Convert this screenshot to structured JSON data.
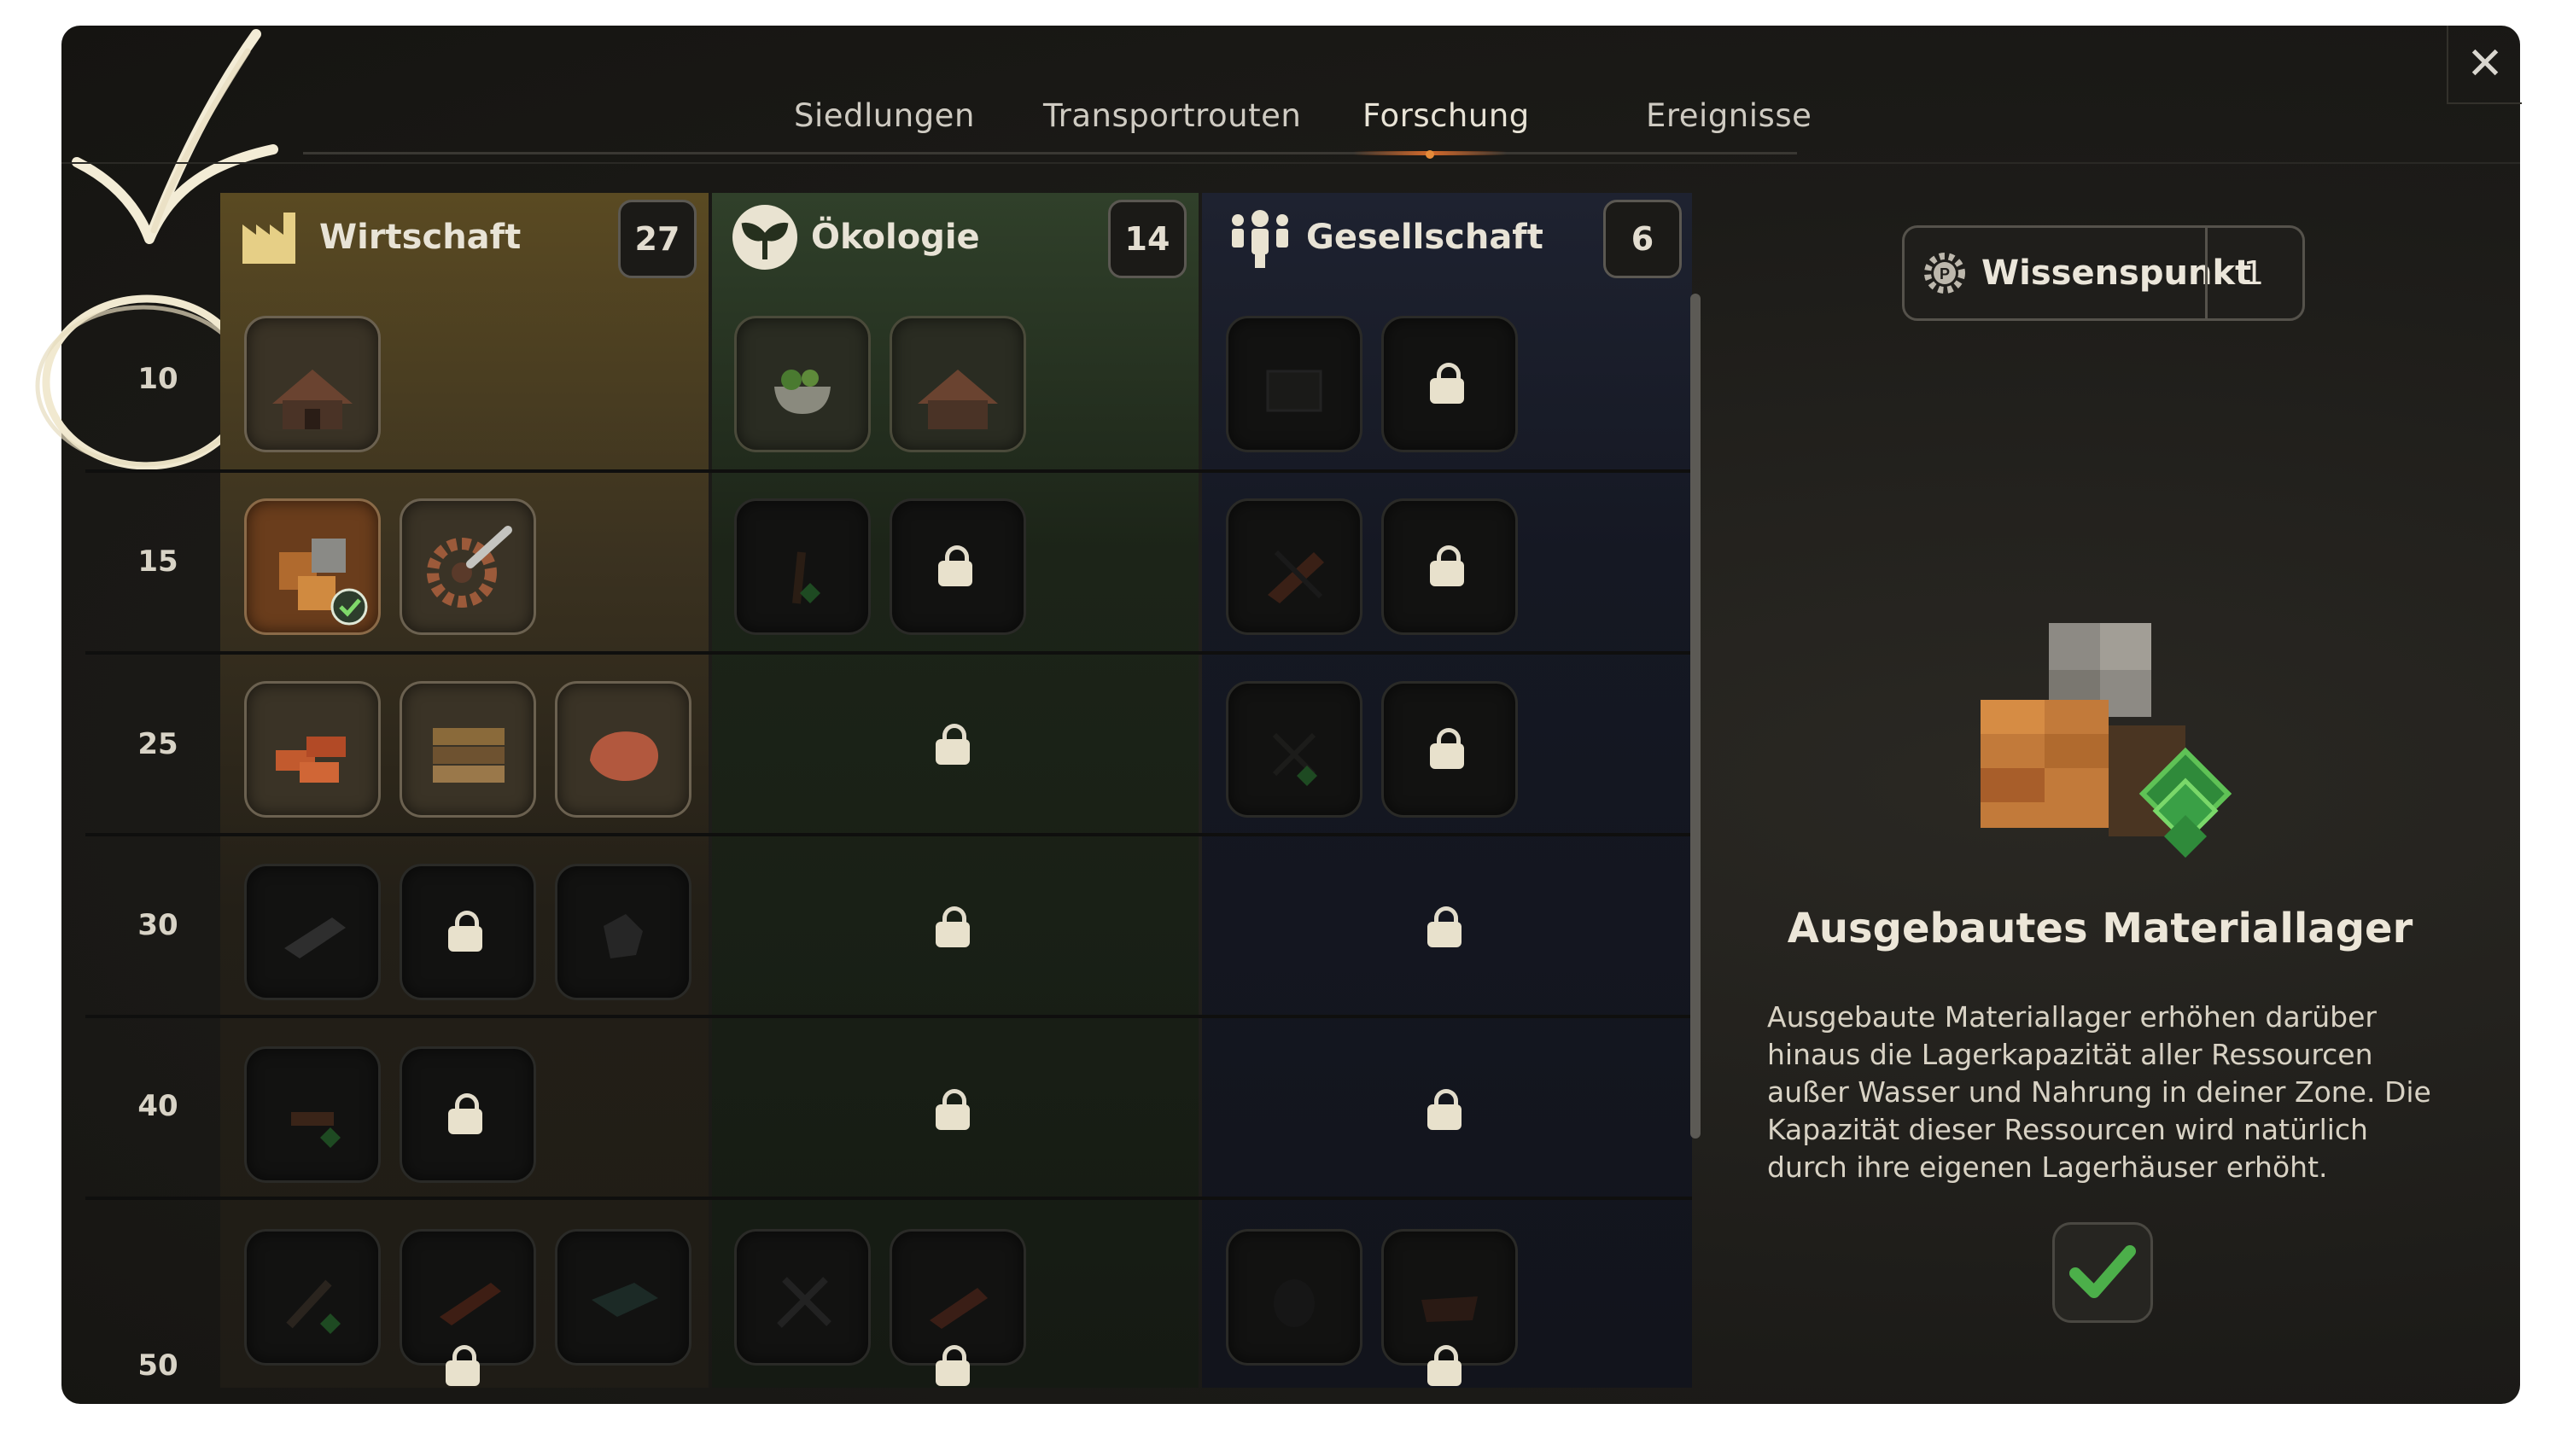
{
  "tabs": [
    {
      "label": "Siedlungen"
    },
    {
      "label": "Transportrouten"
    },
    {
      "label": "Forschung"
    },
    {
      "label": "Ereignisse"
    }
  ],
  "active_tab": "Forschung",
  "categories": [
    {
      "label": "Wirtschaft",
      "count": "27",
      "icon": "factory-icon",
      "color": "#caa84a"
    },
    {
      "label": "Ökologie",
      "count": "14",
      "icon": "leaf-icon",
      "color": "#5e8a3a"
    },
    {
      "label": "Gesellschaft",
      "count": "6",
      "icon": "people-icon",
      "color": "#4a5a86"
    }
  ],
  "rows": [
    "10",
    "15",
    "25",
    "30",
    "40",
    "50"
  ],
  "knowledge": {
    "label": "Wissenspunkt",
    "value": "1",
    "icon": "gear-p-icon"
  },
  "detail": {
    "title": "Ausgebautes Materiallager",
    "description": "Ausgebaute Materiallager erhöhen darüber hinaus die Lagerkapazität aller Ressourcen außer Wasser und Nahrung in deiner Zone. Die Kapazität dieser Ressourcen wird natürlich durch ihre eigenen Lagerhäuser erhöht.",
    "confirm_icon": "checkmark-icon"
  },
  "colors": {
    "accent": "#d46a2c",
    "gold": "#caa84a",
    "check": "#4caf4a"
  }
}
